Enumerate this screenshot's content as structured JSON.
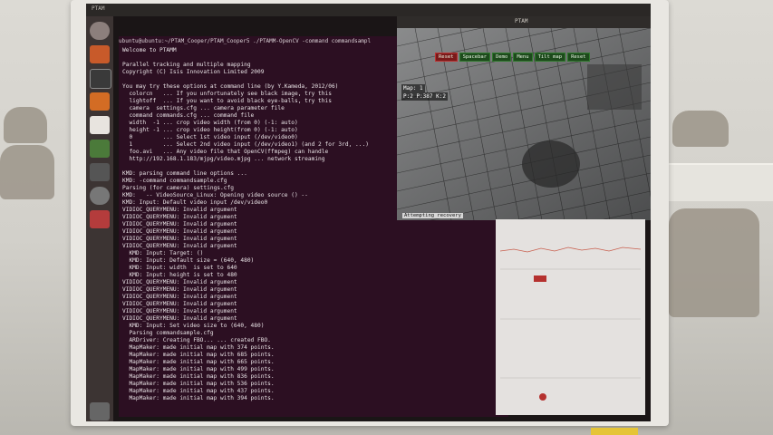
{
  "topbar": {
    "title": "PTAM"
  },
  "ptam_window": {
    "title": "PTAM",
    "menu": [
      "Reset",
      "Spacebar",
      "Demo",
      "Menu",
      "Tilt map",
      "Reset"
    ],
    "map_label": "Map: 1",
    "map_stats": "P:2  P:387  K:2",
    "status": "Attempting recovery"
  },
  "terminal": {
    "title": "ubuntu@ubuntu:~/PTAM_Cooper/PTAM_Cooper5 ./PTAMM-OpenCV -command commandsampl",
    "lines": [
      "Welcome to PTAMM",
      "",
      "Parallel tracking and multiple mapping",
      "Copyright (C) Isis Innovation Limited 2009",
      "",
      "You may try these options at command line (by Y.Kameda, 2012/06)",
      "  colorcn   ... If you unfortunately see black image, try this",
      "  lightoff  ... If you want to avoid black eye-balls, try this",
      "  camera  settings.cfg ... camera parameter file",
      "  command commands.cfg ... command file",
      "  width  -1 ... crop video width (from 0) (-1: auto)",
      "  height -1 ... crop video height(from 0) (-1: auto)",
      "  0         ... Select 1st video input (/dev/video0)",
      "  1         ... Select 2nd video input (/dev/video1) (and 2 for 3rd, ...)",
      "  foo.avi   ... Any video file that OpenCV(ffmpeg) can handle",
      "  http://192.168.1.183/mjpg/video.mjpg ... network streaming",
      "",
      "KMD: parsing command line options ...",
      "KMD: -command commandsample.cfg",
      "Parsing (for camera) settings.cfg",
      "KMD:   -- VideoSource_Linux: Opening video source () --",
      "KMD: Input: Default video input /dev/video0",
      "VIDIOC_QUERYMENU: Invalid argument",
      "VIDIOC_QUERYMENU: Invalid argument",
      "VIDIOC_QUERYMENU: Invalid argument",
      "VIDIOC_QUERYMENU: Invalid argument",
      "VIDIOC_QUERYMENU: Invalid argument",
      "VIDIOC_QUERYMENU: Invalid argument",
      "  KMD: Input: Target: ()",
      "  KMD: Input: Default size = (640, 480)",
      "  KMD: Input: width  is set to 640",
      "  KMD: Input: height is set to 480",
      "VIDIOC_QUERYMENU: Invalid argument",
      "VIDIOC_QUERYMENU: Invalid argument",
      "VIDIOC_QUERYMENU: Invalid argument",
      "VIDIOC_QUERYMENU: Invalid argument",
      "VIDIOC_QUERYMENU: Invalid argument",
      "VIDIOC_QUERYMENU: Invalid argument",
      "  KMD: Input: Set video size to (640, 480)",
      "  Parsing commandsample.cfg",
      "  ARDriver: Creating FBO... ... created FBO.",
      "  MapMaker: made initial map with 374 points.",
      "  MapMaker: made initial map with 685 points.",
      "  MapMaker: made initial map with 665 points.",
      "  MapMaker: made initial map with 499 points.",
      "  MapMaker: made initial map with 836 points.",
      "  MapMaker: made initial map with 536 points.",
      "  MapMaker: made initial map with 437 points.",
      "  MapMaker: made initial map with 394 points."
    ]
  }
}
